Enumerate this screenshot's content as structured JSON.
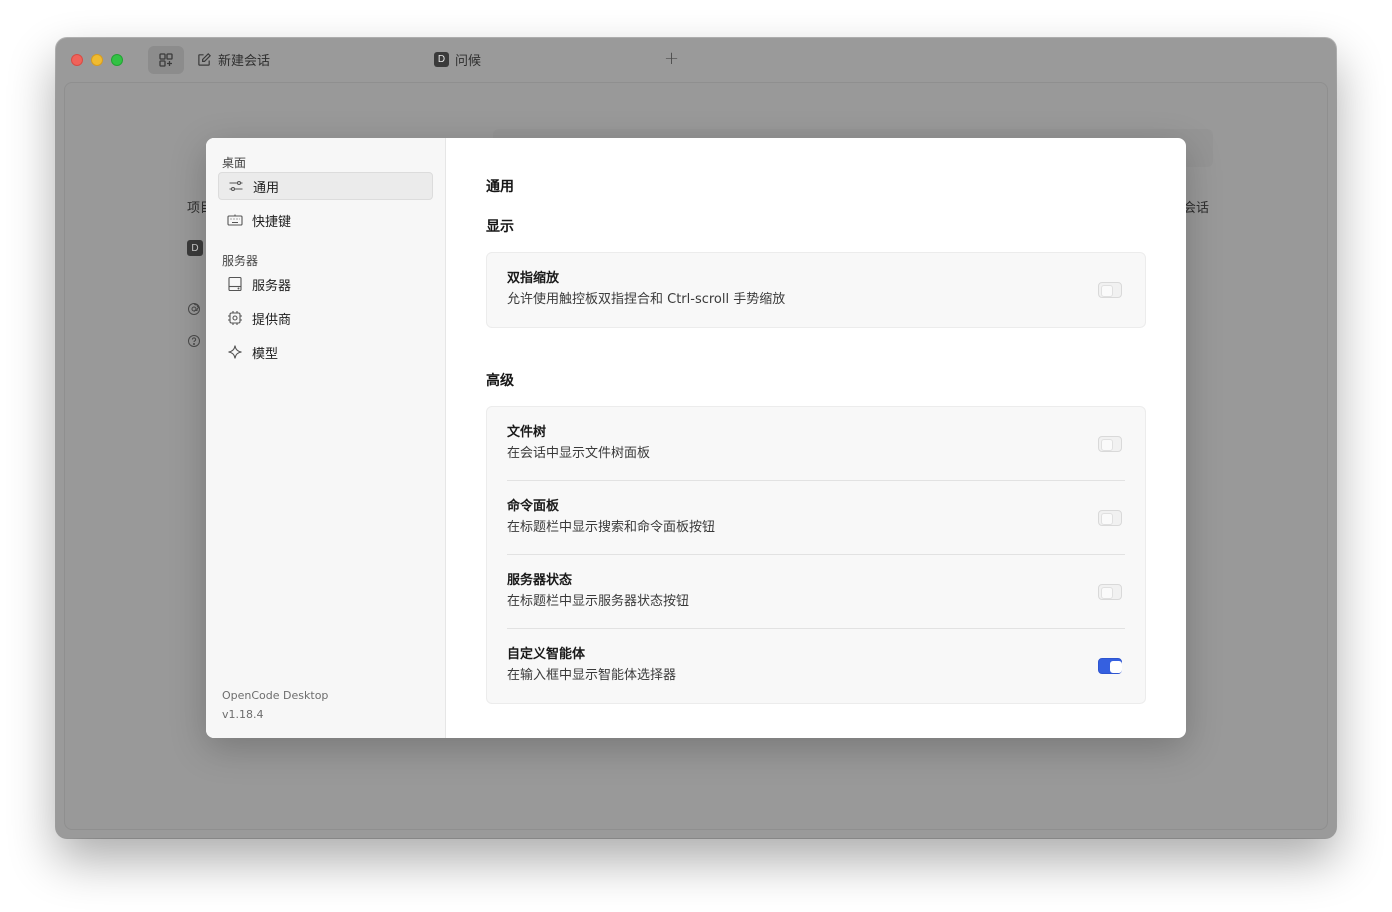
{
  "titlebar": {
    "new_session_label": "新建会话",
    "tab_badge": "D",
    "tab_label": "问候",
    "add_tab_symbol": "+"
  },
  "background": {
    "projects_label": "项目",
    "session_label": "会话",
    "project_badge": "D"
  },
  "settings": {
    "sidebar": {
      "desktop_section": "桌面",
      "items_desktop": [
        {
          "label": "通用",
          "icon": "sliders-icon",
          "active": true
        },
        {
          "label": "快捷键",
          "icon": "keyboard-icon",
          "active": false
        }
      ],
      "server_section": "服务器",
      "items_server": [
        {
          "label": "服务器",
          "icon": "server-icon"
        },
        {
          "label": "提供商",
          "icon": "chip-icon"
        },
        {
          "label": "模型",
          "icon": "sparkle-icon"
        }
      ],
      "app_name": "OpenCode Desktop",
      "version": "v1.18.4"
    },
    "main": {
      "title": "通用",
      "display_group": "显示",
      "display_rows": [
        {
          "title": "双指缩放",
          "desc": "允许使用触控板双指捏合和 Ctrl-scroll 手势缩放",
          "enabled": false
        }
      ],
      "advanced_group": "高级",
      "advanced_rows": [
        {
          "title": "文件树",
          "desc": "在会话中显示文件树面板",
          "enabled": false
        },
        {
          "title": "命令面板",
          "desc": "在标题栏中显示搜索和命令面板按钮",
          "enabled": false
        },
        {
          "title": "服务器状态",
          "desc": "在标题栏中显示服务器状态按钮",
          "enabled": false
        },
        {
          "title": "自定义智能体",
          "desc": "在输入框中显示智能体选择器",
          "enabled": true
        }
      ]
    }
  },
  "colors": {
    "accent": "#3560e0",
    "overlay": "#9a9a9a"
  }
}
